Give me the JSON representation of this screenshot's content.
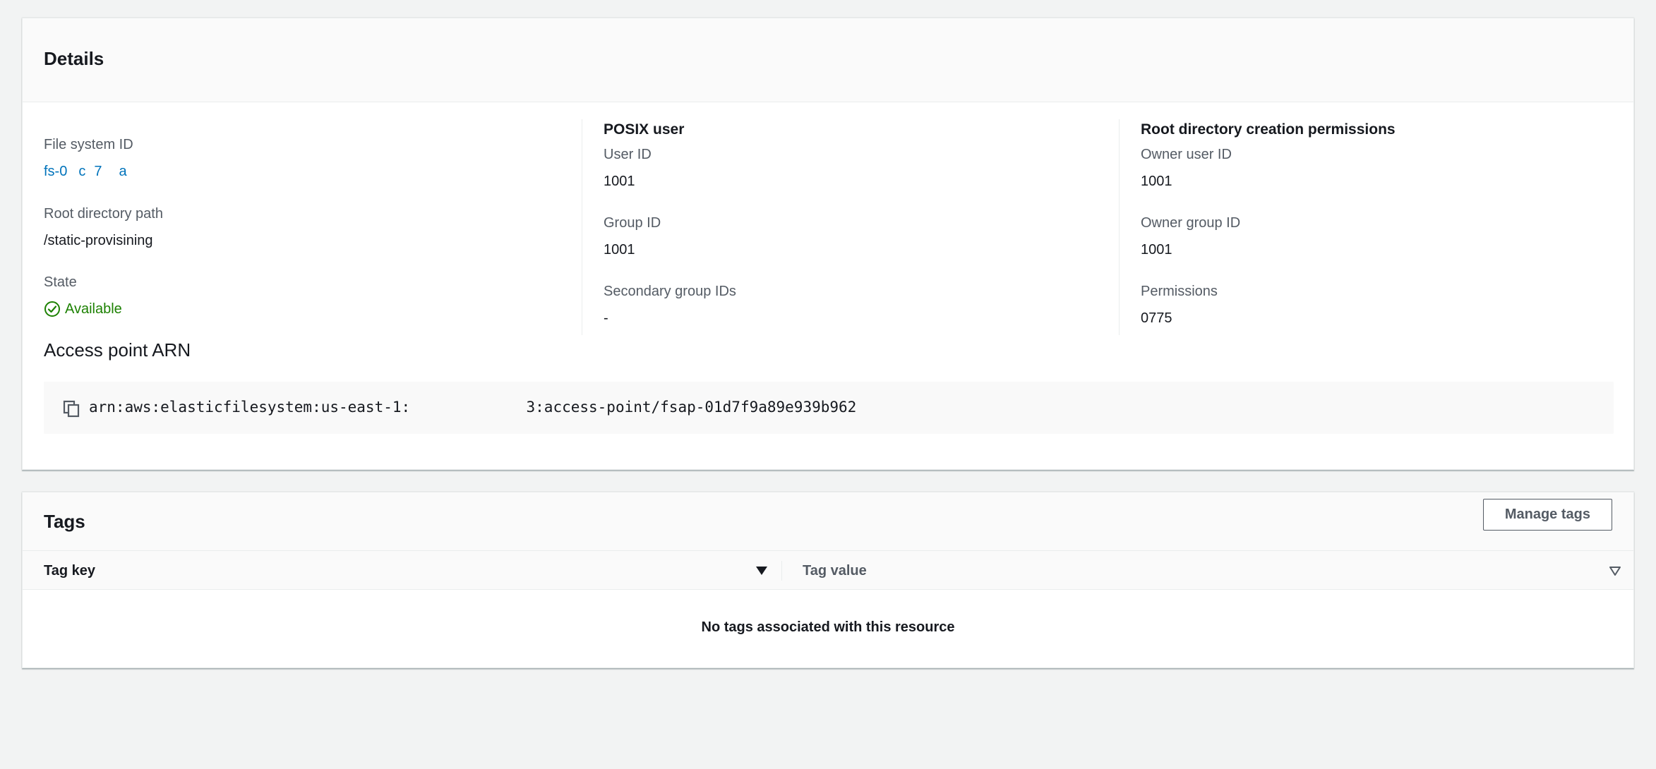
{
  "details": {
    "title": "Details",
    "file_system": {
      "label": "File system ID",
      "value": "fs-0    c   7      a  "
    },
    "root_path": {
      "label": "Root directory path",
      "value": "/static-provisining"
    },
    "state": {
      "label": "State",
      "value": "Available",
      "icon": "check-circle-icon",
      "color": "#1d8102"
    },
    "posix_user": {
      "heading": "POSIX user",
      "user_id": {
        "label": "User ID",
        "value": "1001"
      },
      "group_id": {
        "label": "Group ID",
        "value": "1001"
      },
      "secondary_group_ids": {
        "label": "Secondary group IDs",
        "value": "-"
      }
    },
    "root_permissions": {
      "heading": "Root directory creation permissions",
      "owner_user_id": {
        "label": "Owner user ID",
        "value": "1001"
      },
      "owner_group_id": {
        "label": "Owner group ID",
        "value": "1001"
      },
      "permissions": {
        "label": "Permissions",
        "value": "0775"
      }
    },
    "access_point_arn": {
      "label": "Access point ARN",
      "value": "arn:aws:elasticfilesystem:us-east-1:             3:access-point/fsap-01d7f9a89e939b962",
      "icon": "copy-icon"
    }
  },
  "tags": {
    "title": "Tags",
    "manage_button": "Manage tags",
    "columns": [
      {
        "label": "Tag key",
        "sort_icon": "sort-descending-icon"
      },
      {
        "label": "Tag value",
        "sort_icon": "sort-inactive-icon"
      }
    ],
    "empty_message": "No tags associated with this resource"
  },
  "colors": {
    "link": "#0073bb",
    "success": "#1d8102",
    "label": "#545b64",
    "text": "#16191f",
    "background": "#f2f3f3"
  }
}
